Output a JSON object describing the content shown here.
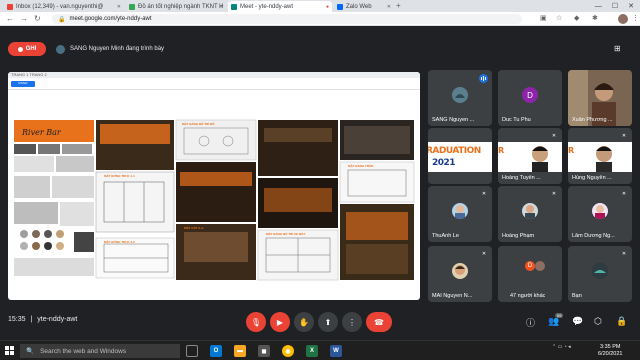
{
  "browser": {
    "tabs": [
      {
        "title": "Inbox (12,349) - van.nguyenthi@",
        "favicon_color": "#ea4335"
      },
      {
        "title": "Đồ án tốt nghiệp ngành TKNT H",
        "favicon_color": "#34a853"
      },
      {
        "title": "Meet - yte-nddy-awt",
        "favicon_color": "#00897b",
        "active": true
      },
      {
        "title": "Zalo Web",
        "favicon_color": "#0068ff"
      }
    ],
    "new_tab": "+",
    "url": "meet.google.com/yte-nddy-awt"
  },
  "meet": {
    "record_label": "GHI",
    "presenter_text": "SANG Nguyen Minh đang trình bày",
    "slide": {
      "header_text": "TRANG 1 TRANG 2",
      "button_label": "RIVER",
      "labels": [
        "MẶT ĐỨNG TRỤC 1-1",
        "MẶT BẰNG BỐ TRÍ ĐỒ",
        "MẶT ĐỨNG TRỤC 2-2",
        "MẶT BẰNG TRẦN",
        "MẶT BẰNG BỐ TRÍ XE MÁY",
        "MẶT CẮT A-A"
      ]
    },
    "participants": [
      {
        "name": "SANG Nguyen ...",
        "kind": "avatar-photo",
        "speaking": true
      },
      {
        "name": "Duc Tu Phu",
        "kind": "letter",
        "letter": "D",
        "color": "#8e24aa"
      },
      {
        "name": "Xuân Phương ...",
        "kind": "video-person"
      },
      {
        "name": "",
        "kind": "graduation"
      },
      {
        "name": "Hoàng Tuyến ...",
        "kind": "graduation-person"
      },
      {
        "name": "Hùng Nguyễn ...",
        "kind": "graduation-person"
      },
      {
        "name": "ThuAnh Le",
        "kind": "avatar-photo"
      },
      {
        "name": "Hoàng Phạm",
        "kind": "avatar-photo"
      },
      {
        "name": "Lâm Dương Ng...",
        "kind": "avatar-photo"
      },
      {
        "name": "MAI Nguyen N...",
        "kind": "avatar-photo"
      },
      {
        "name": "47 người khác",
        "kind": "others"
      },
      {
        "name": "Bạn",
        "kind": "avatar-photo"
      }
    ],
    "graduation_text": "RADUATION",
    "graduation_year": "2021",
    "bottom": {
      "time": "15:35",
      "separator": "|",
      "meeting_code": "yte-nddy-awt",
      "participant_count": "59"
    }
  },
  "taskbar": {
    "search_placeholder": "Search the web and Windows",
    "time": "3:35 PM",
    "date": "6/20/2021",
    "apps": [
      "Outlook",
      "Explorer",
      "Store",
      "Chrome",
      "Excel",
      "Word"
    ]
  },
  "colors": {
    "meet_bg": "#202124",
    "tile_bg": "#3c4043",
    "record_red": "#ea4335",
    "speaking_blue": "#1a73e8"
  }
}
